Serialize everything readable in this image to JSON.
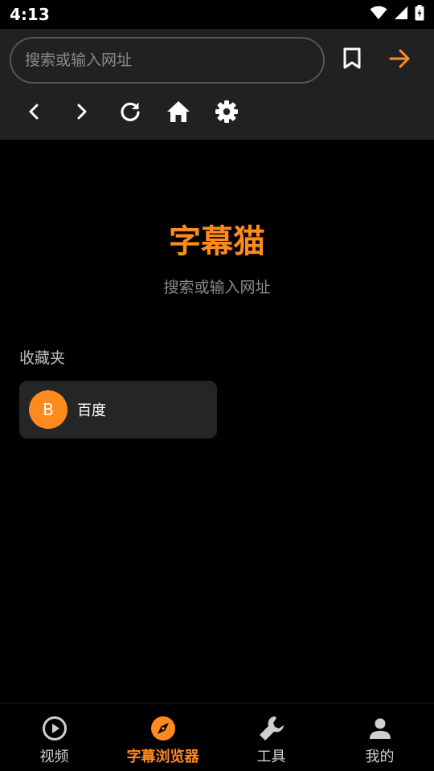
{
  "status_bar": {
    "time": "4:13",
    "icons": [
      "wifi-icon",
      "signal-icon",
      "battery-icon"
    ]
  },
  "browser": {
    "url_placeholder": "搜索或输入网址",
    "toolbar": [
      "bookmark-icon",
      "arrow-right-icon"
    ],
    "nav_buttons": [
      "chevron-left-icon",
      "chevron-right-icon",
      "refresh-icon",
      "home-icon",
      "gear-icon"
    ]
  },
  "home": {
    "title": "字幕猫",
    "subtitle": "搜索或输入网址",
    "favorites_label": "收藏夹",
    "favorites": [
      {
        "initial": "B",
        "name": "百度"
      }
    ]
  },
  "bottom_nav": {
    "items": [
      {
        "label": "视频",
        "icon": "play-circle-icon",
        "active": false
      },
      {
        "label": "字幕浏览器",
        "icon": "compass-icon",
        "active": true
      },
      {
        "label": "工具",
        "icon": "wrench-icon",
        "active": false
      },
      {
        "label": "我的",
        "icon": "person-icon",
        "active": false
      }
    ]
  },
  "colors": {
    "accent": "#ff8a1e",
    "background": "#000000",
    "toolbar_bg": "#212121",
    "card_bg": "#252525",
    "muted_text": "#8a8a8a"
  }
}
